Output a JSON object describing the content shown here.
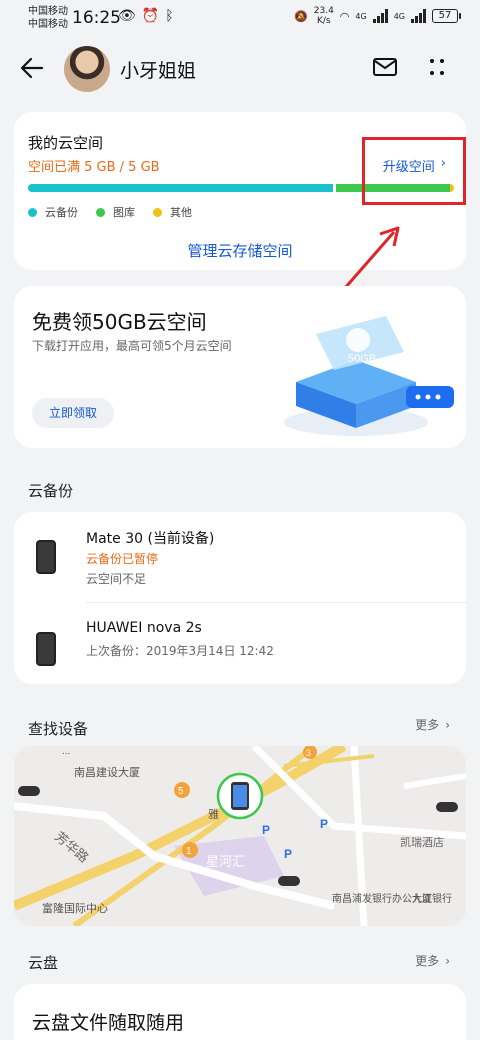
{
  "status_bar": {
    "carrier1": "中国移动",
    "carrier2": "中国移动",
    "time": "16:25",
    "speed_value": "23.4",
    "speed_unit": "K/s",
    "net1": "4G",
    "net2": "4G",
    "battery": "57"
  },
  "header": {
    "username": "小牙姐姐"
  },
  "storage": {
    "title": "我的云空间",
    "usage": "空间已满 5 GB / 5 GB",
    "upgrade_label": "升级空间",
    "bar_fractions": {
      "backup": 0.72,
      "gallery": 0.27,
      "other": 0.01
    },
    "legend": [
      {
        "label": "云备份",
        "color": "#1cc0cc"
      },
      {
        "label": "图库",
        "color": "#3bc84c"
      },
      {
        "label": "其他",
        "color": "#efc119"
      }
    ],
    "manage_label": "管理云存储空间"
  },
  "promo": {
    "title": "免费领50GB云空间",
    "desc": "下载打开应用，最高可领5个月云空间",
    "button": "立即领取",
    "badge": "50GB"
  },
  "backup": {
    "section_title": "云备份",
    "devices": [
      {
        "name": "Mate 30 (当前设备)",
        "status": "云备份已暂停",
        "note": "云空间不足"
      },
      {
        "name": "HUAWEI nova 2s",
        "status": "上次备份：2019年3月14日 12:42"
      }
    ]
  },
  "find_device": {
    "section_title": "查找设备",
    "more": "更多",
    "map_labels": [
      "南昌建设大厦",
      "芳华路",
      "星河汇",
      "富隆国际中心",
      "南昌浦发银行办公大厦",
      "九江银行",
      "凯瑞酒店",
      "雅"
    ],
    "markers": [
      "5",
      "1",
      "3",
      "P",
      "P",
      "P"
    ]
  },
  "cloud_disk": {
    "section_title": "云盘",
    "more": "更多",
    "card_title": "云盘文件随取随用"
  },
  "colors": {
    "accent": "#1659d6",
    "warning": "#e86a17",
    "annotation": "#e0242a"
  }
}
